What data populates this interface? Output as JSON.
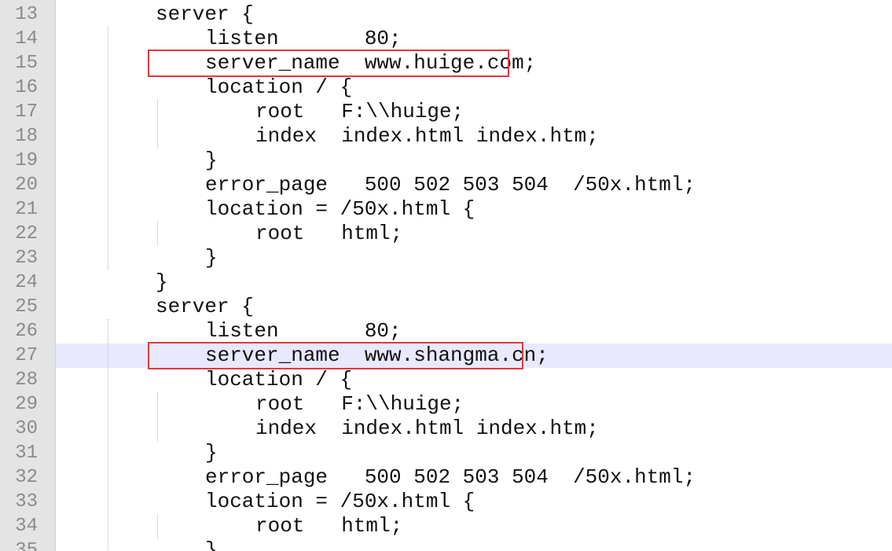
{
  "editor": {
    "lines": [
      {
        "num": "13",
        "indent": 1,
        "text": "server {"
      },
      {
        "num": "14",
        "indent": 2,
        "text": "listen       80;"
      },
      {
        "num": "15",
        "indent": 2,
        "text": "server_name  www.huige.com;"
      },
      {
        "num": "16",
        "indent": 2,
        "text": "location / {"
      },
      {
        "num": "17",
        "indent": 3,
        "text": "root   F:\\\\huige;"
      },
      {
        "num": "18",
        "indent": 3,
        "text": "index  index.html index.htm;"
      },
      {
        "num": "19",
        "indent": 2,
        "text": "}"
      },
      {
        "num": "20",
        "indent": 2,
        "text": "error_page   500 502 503 504  /50x.html;"
      },
      {
        "num": "21",
        "indent": 2,
        "text": "location = /50x.html {"
      },
      {
        "num": "22",
        "indent": 3,
        "text": "root   html;"
      },
      {
        "num": "23",
        "indent": 2,
        "text": "}"
      },
      {
        "num": "24",
        "indent": 1,
        "text": "}"
      },
      {
        "num": "25",
        "indent": 1,
        "text": "server {"
      },
      {
        "num": "26",
        "indent": 2,
        "text": "listen       80;"
      },
      {
        "num": "27",
        "indent": 2,
        "text": "server_name  www.shangma.cn;"
      },
      {
        "num": "28",
        "indent": 2,
        "text": "location / {"
      },
      {
        "num": "29",
        "indent": 3,
        "text": "root   F:\\\\huige;"
      },
      {
        "num": "30",
        "indent": 3,
        "text": "index  index.html index.htm;"
      },
      {
        "num": "31",
        "indent": 2,
        "text": "}"
      },
      {
        "num": "32",
        "indent": 2,
        "text": "error_page   500 502 503 504  /50x.html;"
      },
      {
        "num": "33",
        "indent": 2,
        "text": "location = /50x.html {"
      },
      {
        "num": "34",
        "indent": 3,
        "text": "root   html;"
      },
      {
        "num": "35",
        "indent": 2,
        "text": "}"
      }
    ],
    "current_line": "27",
    "highlighted_lines": [
      "15",
      "27"
    ],
    "colors": {
      "gutter": "#e4e4e4",
      "line_number": "#8a8a8a",
      "current_line": "#e8e8ff",
      "highlight_box": "#e0393e"
    }
  }
}
